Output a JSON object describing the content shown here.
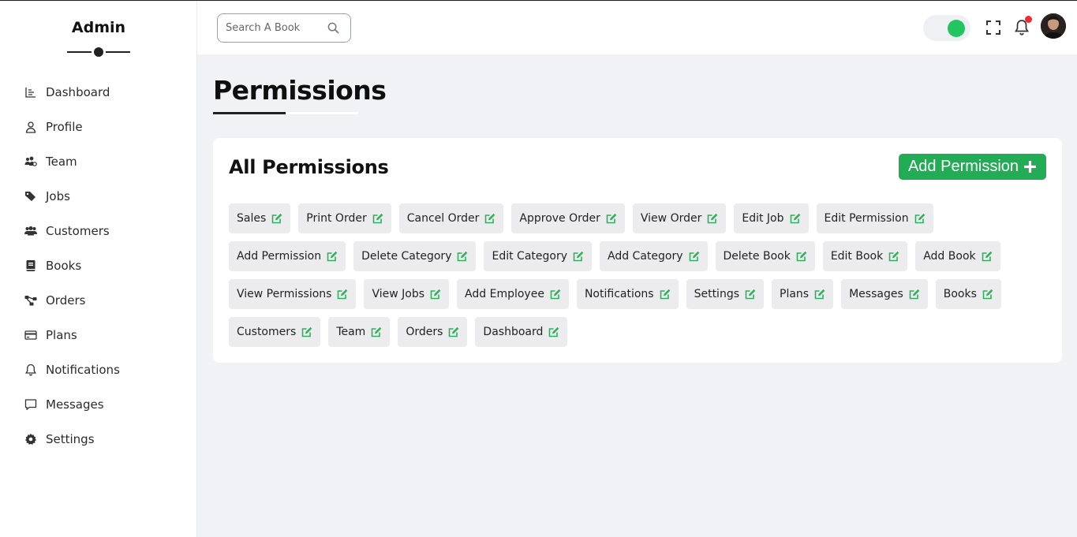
{
  "sidebar": {
    "brand": "Admin",
    "items": [
      {
        "label": "Dashboard",
        "icon": "chart-icon"
      },
      {
        "label": "Profile",
        "icon": "user-icon"
      },
      {
        "label": "Team",
        "icon": "team-icon"
      },
      {
        "label": "Jobs",
        "icon": "tags-icon"
      },
      {
        "label": "Customers",
        "icon": "users-icon"
      },
      {
        "label": "Books",
        "icon": "book-icon"
      },
      {
        "label": "Orders",
        "icon": "sitemap-icon"
      },
      {
        "label": "Plans",
        "icon": "credit-card-icon"
      },
      {
        "label": "Notifications",
        "icon": "bell-icon"
      },
      {
        "label": "Messages",
        "icon": "message-icon"
      },
      {
        "label": "Settings",
        "icon": "gear-icon"
      }
    ]
  },
  "header": {
    "search_placeholder": "Search A Book",
    "theme_toggle_on": true,
    "notification_dot": true
  },
  "page": {
    "title": "Permissions"
  },
  "card": {
    "title": "All Permissions",
    "add_button_label": "Add Permission",
    "permissions": [
      "Sales",
      "Print Order",
      "Cancel Order",
      "Approve Order",
      "View Order",
      "Edit Job",
      "Edit Permission",
      "Add Permission",
      "Delete Category",
      "Edit Category",
      "Add Category",
      "Delete Book",
      "Edit Book",
      "Add Book",
      "View Permissions",
      "View Jobs",
      "Add Employee",
      "Notifications",
      "Settings",
      "Plans",
      "Messages",
      "Books",
      "Customers",
      "Team",
      "Orders",
      "Dashboard"
    ]
  },
  "colors": {
    "accent": "#22ac55",
    "toggle_knob": "#22c55e",
    "notification_dot": "#ef2b2b",
    "page_bg": "#f0f2f6",
    "chip_bg": "#ececee"
  }
}
